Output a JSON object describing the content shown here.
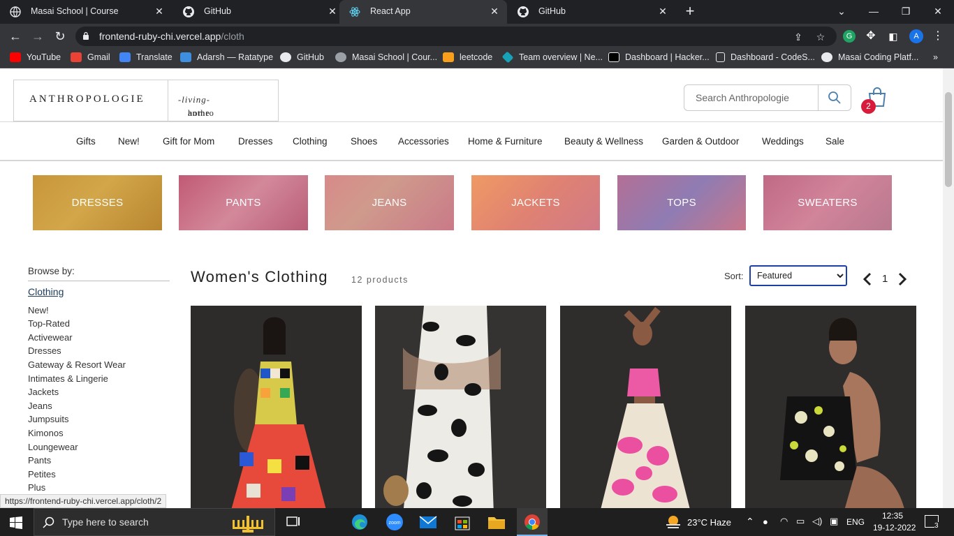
{
  "browser": {
    "tabs": [
      {
        "title": "Masai School | Course",
        "icon": "globe-icon"
      },
      {
        "title": "GitHub",
        "icon": "github-icon"
      },
      {
        "title": "React App",
        "icon": "react-icon",
        "active": true
      },
      {
        "title": "GitHub",
        "icon": "github-icon"
      }
    ],
    "url_host": "frontend-ruby-chi.vercel.app",
    "url_path": "/cloth",
    "profile_initial": "A",
    "extension_letter": "G",
    "bookmarks": [
      "YouTube",
      "Gmail",
      "Translate",
      "Adarsh — Ratatype",
      "GitHub",
      "Masai School | Cour...",
      "leetcode",
      "Team overview | Ne...",
      "Dashboard | Hacker...",
      "Dashboard - CodeS...",
      "Masai Coding Platf..."
    ],
    "status_url": "https://frontend-ruby-chi.vercel.app/cloth/2"
  },
  "header": {
    "logo": "ANTHROPOLOGIE",
    "logo_home_prefix": "anthro",
    "logo_home_script": "living",
    "logo_home_suffix": "home",
    "search_placeholder": "Search Anthropologie",
    "cart_count": "2"
  },
  "nav": {
    "items": [
      "Gifts",
      "New!",
      "Gift for Mom",
      "Dresses",
      "Clothing",
      "Shoes",
      "Accessories",
      "Home & Furniture",
      "Beauty & Wellness",
      "Garden & Outdoor",
      "Weddings",
      "Sale"
    ]
  },
  "categories": [
    {
      "label": "DRESSES",
      "color": "#c99a3a"
    },
    {
      "label": "PANTS",
      "color": "#c9687e"
    },
    {
      "label": "JEANS",
      "color": "#d98e8e"
    },
    {
      "label": "JACKETS",
      "color": "#e58a6a"
    },
    {
      "label": "TOPS",
      "color": "#a27aa8"
    },
    {
      "label": "SWEATERS",
      "color": "#c97c92"
    }
  ],
  "sidebar": {
    "browse_label": "Browse by:",
    "current": "Clothing",
    "links": [
      "New!",
      "Top-Rated",
      "Activewear",
      "Dresses",
      "Gateway & Resort Wear",
      "Intimates & Lingerie",
      "Jackets",
      "Jeans",
      "Jumpsuits",
      "Kimonos",
      "Loungewear",
      "Pants",
      "Petites",
      "Plus"
    ]
  },
  "listing": {
    "title": "Women's Clothing",
    "count": "12 products",
    "sort_label": "Sort:",
    "sort_value": "Featured",
    "page": "1"
  },
  "taskbar": {
    "search_placeholder": "Type here to search",
    "weather": "23°C  Haze",
    "lang": "ENG",
    "time": "12:35",
    "date": "19-12-2022",
    "notifications": "3"
  }
}
